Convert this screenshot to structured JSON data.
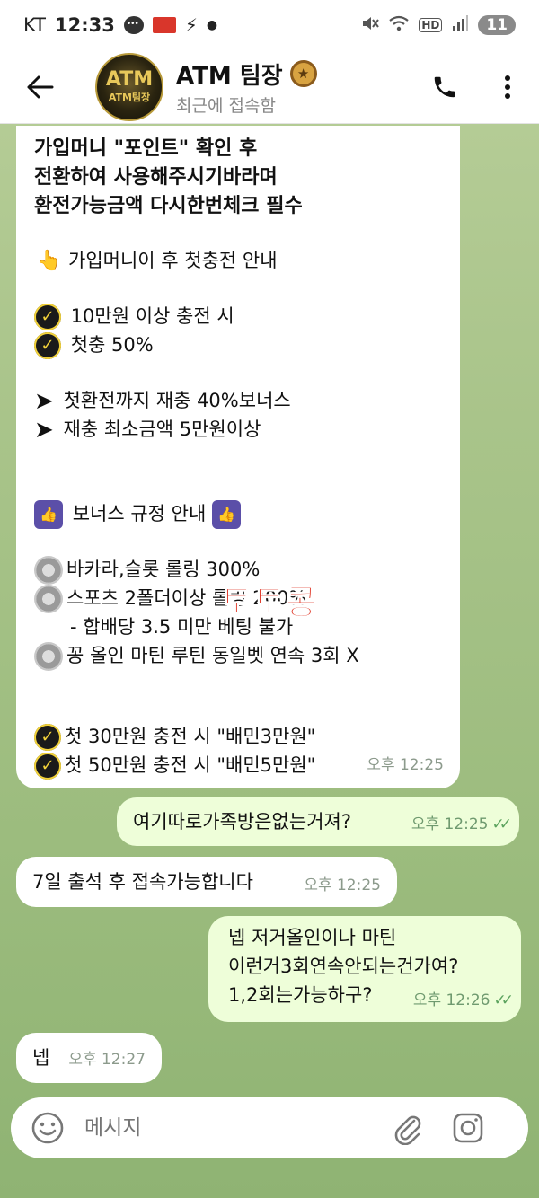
{
  "status_bar": {
    "carrier": "KT",
    "time": "12:33",
    "battery": "11",
    "icons": [
      "chat-bubble-icon",
      "red-app-icon",
      "bolt-icon",
      "dot-icon",
      "mute-icon",
      "wifi-icon",
      "hd-icon",
      "signal-icon"
    ]
  },
  "header": {
    "title": "ATM 팀장",
    "status": "최근에 접속함",
    "avatar_text_top": "ATM",
    "avatar_text_bottom": "ATM팀장",
    "medal_icon": "medal-icon"
  },
  "messages": {
    "big": {
      "lines": {
        "l1": "가입머니 \"포인트\" 확인 후",
        "l2": "전환하여 사용해주시기바라며",
        "l3": "환전가능금액 다시한번체크 필수",
        "l4": "가입머니이 후 첫충전 안내",
        "l5": "10만원 이상 충전 시",
        "l6": "첫충 50%",
        "l7": "첫환전까지 재충 40%보너스",
        "l8": "재충 최소금액 5만원이상",
        "l9": "보너스 규정 안내",
        "l10": "바카라,슬롯 롤링 300%",
        "l11": "스포츠 2폴더이상 롤링 200%",
        "l12": "- 합배당 3.5 미만 베팅 불가",
        "l13": "꽁 올인 마틴 루틴 동일벳 연속 3회 X",
        "l14": "첫 30만원 충전 시 \"배민3만원\"",
        "l15": "첫 50만원 충전 시 \"배민5만원\""
      },
      "time": "오후 12:25",
      "watermark": "토토콩"
    },
    "m2": {
      "text": "여기따로가족방은없는거져?",
      "time": "오후 12:25"
    },
    "m3": {
      "text": "7일 출석 후 접속가능합니다",
      "time": "오후 12:25"
    },
    "m4": {
      "line1": "넵 저거올인이나 마틴",
      "line2": "이런거3회연속안되는건가여?",
      "line3": "1,2회는가능하구?",
      "time": "오후 12:26"
    },
    "m5": {
      "text": "넵",
      "time": "오후 12:27"
    }
  },
  "input": {
    "placeholder": "메시지"
  },
  "colors": {
    "incoming_bubble": "#ffffff",
    "outgoing_bubble": "#eefed9",
    "read_check": "#5da45f",
    "watermark": "#e03a2a"
  }
}
